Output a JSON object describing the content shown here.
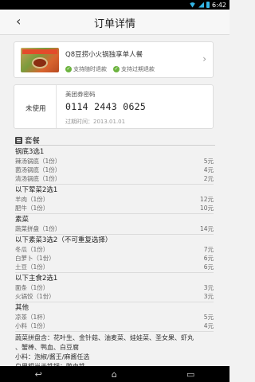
{
  "status_bar": {
    "time": "6:42",
    "wifi_icon": "wifi-icon",
    "signal_icon": "signal-icon",
    "battery_icon": "battery-icon"
  },
  "header": {
    "back_icon": "‹",
    "title": "订单详情"
  },
  "deal": {
    "title": "Q8豆捞小火锅独享单人餐",
    "tags": [
      {
        "icon": "✓",
        "label": "支持随时退款"
      },
      {
        "icon": "✓",
        "label": "支持过期退款"
      }
    ],
    "chevron": "›"
  },
  "coupon": {
    "status": "未使用",
    "label": "美团券密码",
    "code": "0114 2443 0625",
    "expiry": "过期时间：2013.01.01"
  },
  "package": {
    "heading": "套餐",
    "groups": [
      {
        "title": "锅底3选1",
        "items": [
          {
            "name": "辣汤锅底（1份）",
            "price": "5元"
          },
          {
            "name": "菌汤锅底（1份）",
            "price": "4元"
          },
          {
            "name": "清汤锅底（1份）",
            "price": "2元"
          }
        ]
      },
      {
        "title": "以下荤菜2选1",
        "items": [
          {
            "name": "羊肉（1份）",
            "price": "12元"
          },
          {
            "name": "肥牛（1份）",
            "price": "10元"
          }
        ]
      },
      {
        "title": "素菜",
        "items": [
          {
            "name": "蔬菜拼盘（1份）",
            "price": "14元"
          }
        ]
      },
      {
        "title": "以下素菜3选2（不可重复选择）",
        "items": [
          {
            "name": "冬瓜（1份）",
            "price": "7元"
          },
          {
            "name": "白萝卜（1份）",
            "price": "6元"
          },
          {
            "name": "土豆（1份）",
            "price": "6元"
          }
        ]
      },
      {
        "title": "以下主食2选1",
        "items": [
          {
            "name": "面条（1份）",
            "price": "3元"
          },
          {
            "name": "火锅饺（1份）",
            "price": "3元"
          }
        ]
      },
      {
        "title": "其他",
        "items": [
          {
            "name": "凉茶（1杯）",
            "price": "5元"
          },
          {
            "name": "小料（1份）",
            "price": "4元"
          }
        ]
      }
    ],
    "notes": [
      "蔬菜拼盘含：花叶生、金针菇、油麦菜、娃娃菜、圣女果、虾丸",
      "、蟹棒、鸭血、白豆腐",
      "小料：泡椒/酱王/麻酱任选",
      "白果相当于铁锅：鸭血铁"
    ]
  },
  "android_nav": {
    "back": "↩",
    "home": "⌂",
    "recent": "▭"
  }
}
